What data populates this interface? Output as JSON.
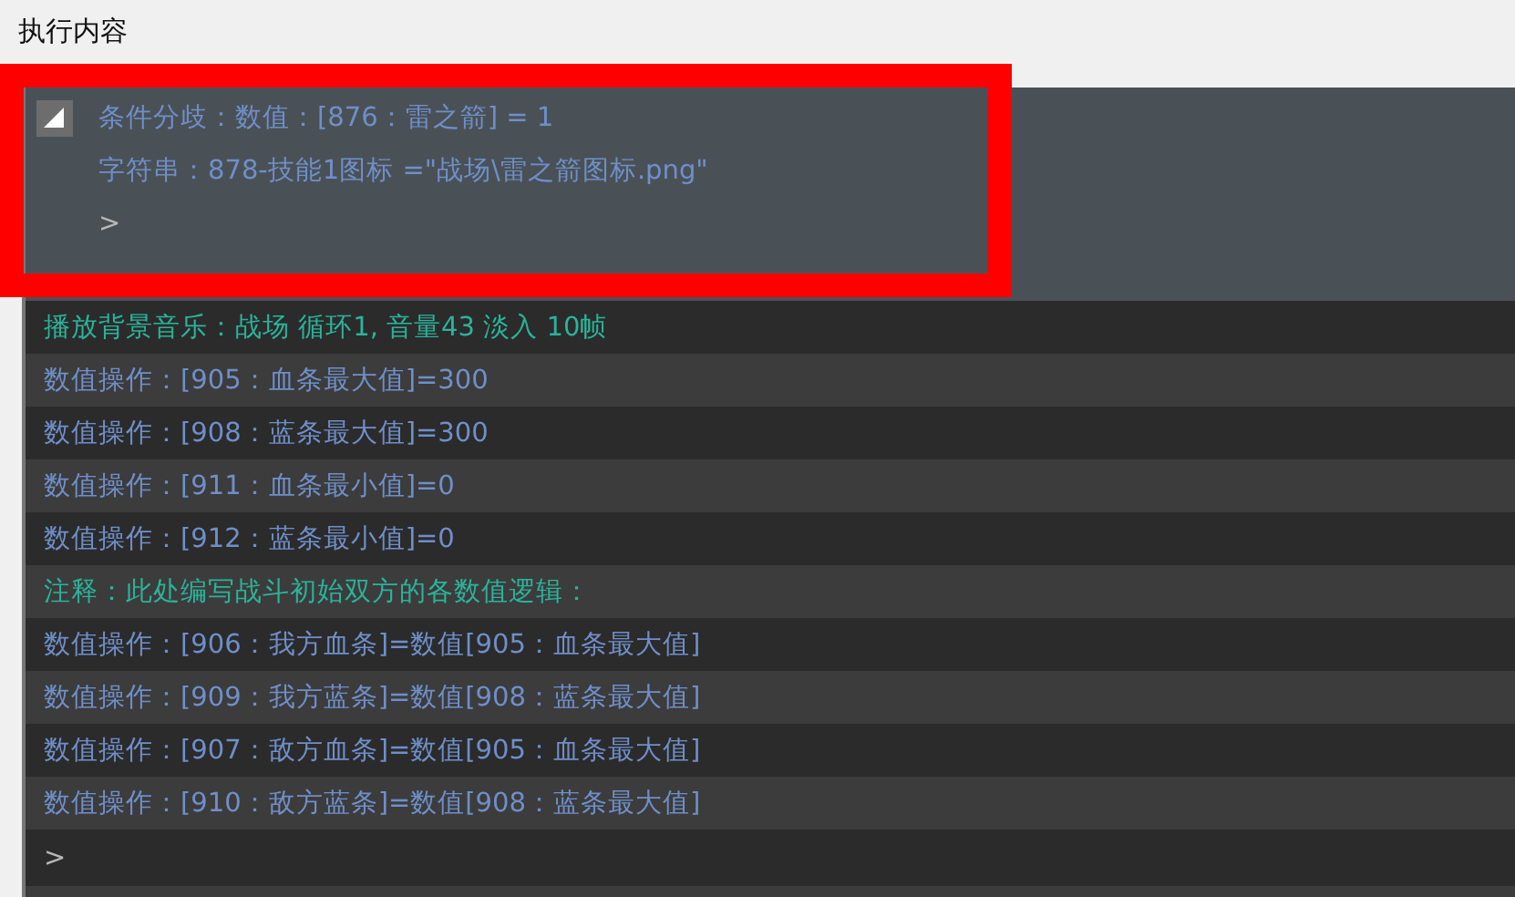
{
  "title": "执行内容",
  "branch": {
    "text": "条件分歧：数值：[876：雷之箭] = 1",
    "expanded": true,
    "children": [
      {
        "kind": "string",
        "text": "字符串：878-技能1图标 =\"战场\\雷之箭图标.png\""
      },
      {
        "kind": "insert",
        "text": ">"
      }
    ]
  },
  "rows": [
    {
      "kind": "music",
      "text": "播放背景音乐：战场 循环1, 音量43 淡入 10帧"
    },
    {
      "kind": "numeric",
      "text": "数值操作：[905：血条最大值]=300"
    },
    {
      "kind": "numeric",
      "text": "数值操作：[908：蓝条最大值]=300"
    },
    {
      "kind": "numeric",
      "text": "数值操作：[911：血条最小值]=0"
    },
    {
      "kind": "numeric",
      "text": "数值操作：[912：蓝条最小值]=0"
    },
    {
      "kind": "comment",
      "text": "注释：此处编写战斗初始双方的各数值逻辑："
    },
    {
      "kind": "numeric",
      "text": "数值操作：[906：我方血条]=数值[905：血条最大值]"
    },
    {
      "kind": "numeric",
      "text": "数值操作：[909：我方蓝条]=数值[908：蓝条最大值]"
    },
    {
      "kind": "numeric",
      "text": "数值操作：[907：敌方血条]=数值[905：血条最大值]"
    },
    {
      "kind": "numeric",
      "text": "数值操作：[910：敌方蓝条]=数值[908：蓝条最大值]"
    },
    {
      "kind": "insert",
      "text": ">"
    }
  ]
}
